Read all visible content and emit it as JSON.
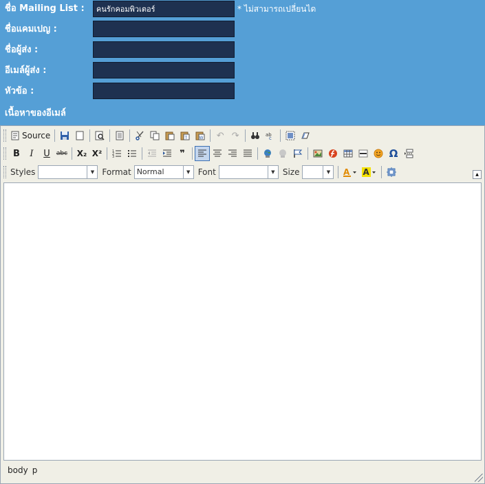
{
  "form": {
    "mailing_list_label": "ชื่อ Mailing List :",
    "mailing_list_value": "คนรักคอมพิวเตอร์",
    "mailing_list_note": "* ไม่สามารถเปลี่ยนได",
    "campaign_label": "ชื่อแคมเปญ :",
    "sender_name_label": "ชื่อผู้ส่ง :",
    "sender_email_label": "อีเมล์ผู้ส่ง :",
    "subject_label": "หัวข้อ :",
    "content_label": "เนื้อหาของอีเมล์"
  },
  "toolbar": {
    "source_label": "Source",
    "styles_label": "Styles",
    "styles_value": "",
    "format_label": "Format",
    "format_value": "Normal",
    "font_label": "Font",
    "font_value": "",
    "size_label": "Size",
    "size_value": "",
    "bold": "B",
    "italic": "I",
    "underline": "U",
    "strike": "abc",
    "subscript": "X₂",
    "superscript": "X²",
    "omega": "Ω",
    "quote": "❞"
  },
  "path_bar": [
    "body",
    "p"
  ]
}
